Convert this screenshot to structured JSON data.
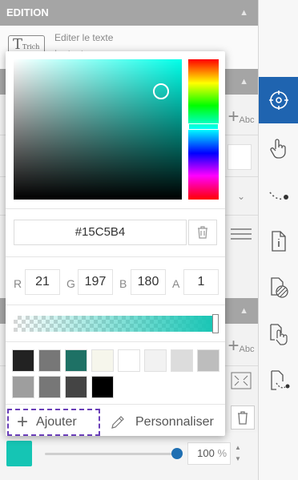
{
  "panel": {
    "section_title": "EDITION",
    "edit_text_label": "Editer le texte",
    "edit_text_sub": "Le texte",
    "text_icon_label": "Trich",
    "abc_label": "Abc",
    "opacity_value": 100,
    "opacity_text": "100",
    "percent_sign": "%"
  },
  "picker": {
    "hex_value": "#15C5B4",
    "channels": [
      {
        "label": "R",
        "value": "21"
      },
      {
        "label": "G",
        "value": "197"
      },
      {
        "label": "B",
        "value": "180"
      },
      {
        "label": "A",
        "value": "1"
      }
    ],
    "swatches": [
      "#222222",
      "#777777",
      "#1e7165",
      "#f6f6ec",
      "#ffffff",
      "#f2f2f2",
      "#dcdcdc",
      "#bdbdbd",
      "#9e9e9e",
      "#777777",
      "#444444",
      "#000000"
    ],
    "add_label": "Ajouter",
    "customize_label": "Personnaliser"
  },
  "toolbar": {
    "tools": [
      "target-icon",
      "touch-icon",
      "dotted-path-icon",
      "document-info-icon",
      "texture-icon",
      "touch-pages-icon",
      "document-path-icon"
    ],
    "active_tool": "target-icon"
  },
  "colors": {
    "accent": "#1f64b0",
    "selected": "#15C5B4",
    "focus": "#6a3fb8"
  }
}
